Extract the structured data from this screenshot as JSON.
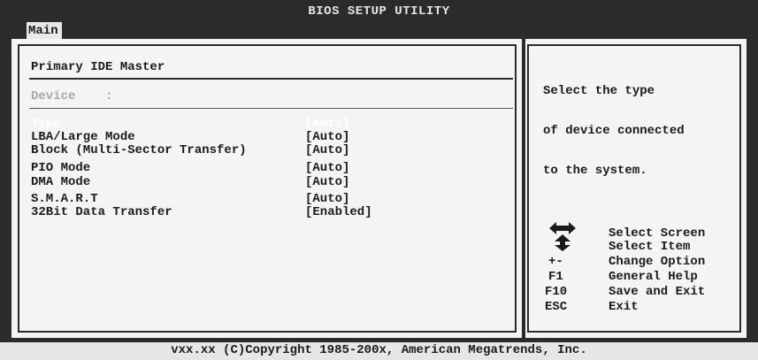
{
  "header": {
    "title": "BIOS SETUP UTILITY",
    "tab_main": "Main"
  },
  "left_panel": {
    "heading": "Primary IDE Master",
    "device_label": "Device    :",
    "settings": [
      {
        "label": "Type",
        "value": "[Auto]"
      },
      {
        "label": "LBA/Large Mode",
        "value": "[Auto]"
      },
      {
        "label": "Block (Multi-Sector Transfer)",
        "value": "[Auto]"
      },
      {
        "label": "PIO Mode",
        "value": "[Auto]"
      },
      {
        "label": "DMA Mode",
        "value": "[Auto]"
      },
      {
        "label": "S.M.A.R.T",
        "value": "[Auto]"
      },
      {
        "label": "32Bit Data Transfer",
        "value": "[Enabled]"
      }
    ]
  },
  "right_panel": {
    "help_line1": "Select the type",
    "help_line2": "of device connected",
    "help_line3": "to the system.",
    "keys": [
      {
        "key": "",
        "action": "Select Screen"
      },
      {
        "key": "",
        "action": "Select Item"
      },
      {
        "key": "+-",
        "action": "Change Option"
      },
      {
        "key": "F1",
        "action": "General Help"
      },
      {
        "key": "F10",
        "action": "Save and Exit"
      },
      {
        "key": "ESC",
        "action": "Exit"
      }
    ],
    "nav_icon": "arrows-icon"
  },
  "footer": {
    "copyright": "vxx.xx (C)Copyright 1985-200x, American Megatrends, Inc."
  },
  "colors": {
    "background": "#2b2b2b",
    "panel": "#f4f4f4",
    "selected_text": "#ffffff",
    "disabled_text": "#a8a8a8"
  }
}
